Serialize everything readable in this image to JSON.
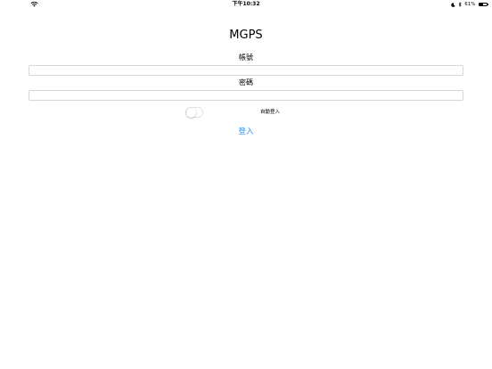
{
  "status_bar": {
    "time": "下午10:32",
    "battery_percent_text": "61%",
    "battery_level": 0.61,
    "icons": [
      "wifi-icon",
      "moon-icon",
      "bluetooth-icon",
      "battery-icon"
    ]
  },
  "app": {
    "title": "MGPS"
  },
  "form": {
    "account_label": "帳號",
    "account_value": "",
    "password_label": "密碼",
    "password_value": "",
    "auto_login_label": "自動登入",
    "auto_login_on": false,
    "login_button_label": "登入"
  },
  "colors": {
    "accent": "#1e88ff",
    "field_border": "#d6d6d6",
    "background": "#ffffff"
  }
}
